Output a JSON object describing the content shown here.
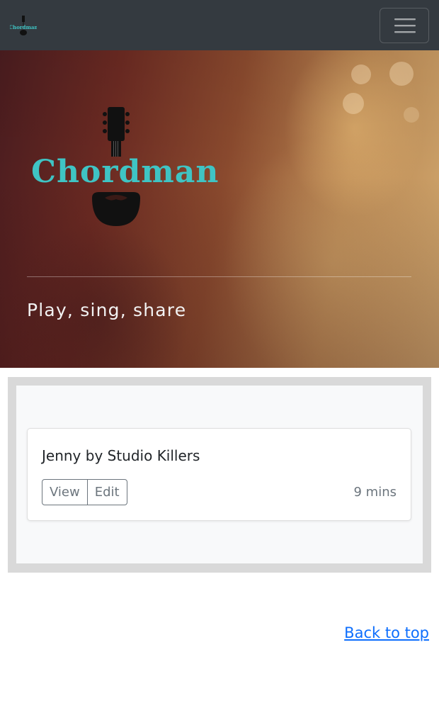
{
  "navbar": {
    "brand_logo_icon": "chordman-logo-icon",
    "menu_icon": "hamburger-menu-icon"
  },
  "hero": {
    "logo_text": "Chordman",
    "tagline": "Play, sing, share"
  },
  "songs": [
    {
      "title": "Jenny by Studio Killers",
      "view_label": "View",
      "edit_label": "Edit",
      "duration": "9 mins"
    }
  ],
  "footer": {
    "back_to_top": "Back to top"
  },
  "colors": {
    "navbar_bg": "#343a40",
    "logo_teal": "#3fc4c4",
    "link_blue": "#0d6efd",
    "secondary": "#6c757d"
  }
}
